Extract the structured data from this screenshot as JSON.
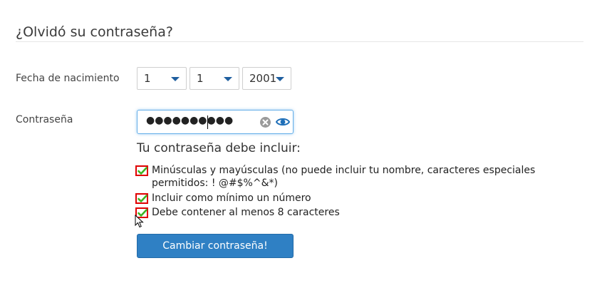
{
  "page": {
    "title": "¿Olvidó su contraseña?"
  },
  "birth_date": {
    "label": "Fecha de nacimiento",
    "day": "1",
    "month": "1",
    "year": "2001"
  },
  "password": {
    "label": "Contraseña",
    "masked_value": "●●●●●●●●●●",
    "clear_icon": "clear-icon",
    "toggle_icon": "eye-icon"
  },
  "requirements": {
    "heading": "Tu contraseña debe incluir:",
    "items": [
      {
        "text": "Minúsculas y mayúsculas (no puede incluir tu nombre, caracteres especiales permitidos: ! @#$%^&*)",
        "met": true
      },
      {
        "text": "Incluir como mínimo un número",
        "met": true
      },
      {
        "text": "Debe contener al menos 8 caracteres",
        "met": true
      }
    ]
  },
  "actions": {
    "submit_label": "Cambiar contraseña!"
  },
  "colors": {
    "accent": "#2f80c4",
    "check_green": "#3cb521",
    "check_border": "#e00000",
    "caret_blue": "#1f5f9f"
  }
}
